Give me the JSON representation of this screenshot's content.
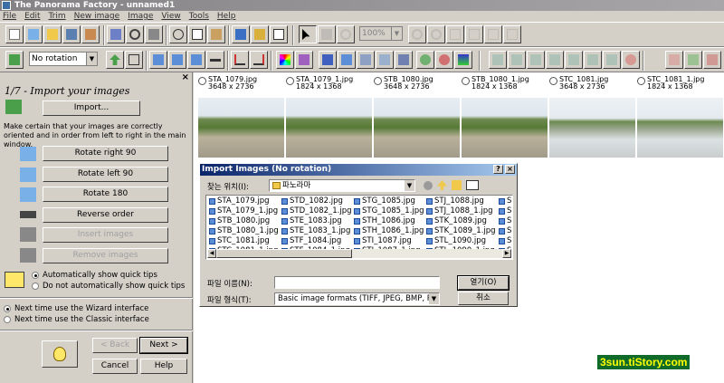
{
  "window": {
    "title": "The Panorama Factory - unnamed1"
  },
  "menu": [
    "File",
    "Edit",
    "Trim",
    "New image",
    "Image",
    "View",
    "Tools",
    "Help"
  ],
  "toolbar": {
    "rotation_select": "No rotation",
    "zoom_select": "100%"
  },
  "wizard": {
    "close": "×",
    "title": "1/7 - Import your images",
    "import_button": "Import...",
    "instructions": "Make certain that your images are correctly oriented and in order from left to right in the main window.",
    "buttons": [
      "Rotate right 90",
      "Rotate left 90",
      "Rotate 180",
      "Reverse order",
      "Insert images",
      "Remove images"
    ],
    "quick_tips": [
      "Automatically show quick tips",
      "Do not automatically show quick tips"
    ],
    "interface": [
      "Next time use the Wizard interface",
      "Next time use the Classic interface"
    ],
    "nav": {
      "back": "< Back",
      "next": "Next >",
      "cancel": "Cancel",
      "help": "Help"
    }
  },
  "thumbnails": [
    {
      "name": "STA_1079.jpg",
      "size": "3648 x 2736"
    },
    {
      "name": "STA_1079_1.jpg",
      "size": "1824 x 1368"
    },
    {
      "name": "STB_1080.jpg",
      "size": "3648 x 2736"
    },
    {
      "name": "STB_1080_1.jpg",
      "size": "1824 x 1368"
    },
    {
      "name": "STC_1081.jpg",
      "size": "3648 x 2736"
    },
    {
      "name": "STC_1081_1.jpg",
      "size": "1824 x 1368"
    }
  ],
  "dialog": {
    "title": "Import Images (No rotation)",
    "help_btn": "?",
    "close_btn": "×",
    "look_in_label": "찾는 위치(I):",
    "look_in_value": "파노라마",
    "files": [
      [
        "STA_1079.jpg",
        "STA_1079_1.jpg",
        "STB_1080.jpg",
        "STB_1080_1.jpg",
        "STC_1081.jpg",
        "STC_1081_1.jpg"
      ],
      [
        "STD_1082.jpg",
        "STD_1082_1.jpg",
        "STE_1083.jpg",
        "STE_1083_1.jpg",
        "STF_1084.jpg",
        "STF_1084_1.jpg"
      ],
      [
        "STG_1085.jpg",
        "STG_1085_1.jpg",
        "STH_1086.jpg",
        "STH_1086_1.jpg",
        "STI_1087.jpg",
        "STI_1087_1.jpg"
      ],
      [
        "STJ_1088.jpg",
        "STJ_1088_1.jpg",
        "STK_1089.jpg",
        "STK_1089_1.jpg",
        "STL_1090.jpg",
        "STL_1090_1.jpg"
      ],
      [
        "S",
        "S",
        "S",
        "S",
        "S",
        "S"
      ]
    ],
    "filename_label": "파일 이름(N):",
    "filename_value": "",
    "filetype_label": "파일 형식(T):",
    "filetype_value": "Basic image formats (TIFF, JPEG, BMP, PN",
    "open": "열기(O)",
    "cancel": "취소"
  },
  "watermark": "3sun.tiStory.com"
}
